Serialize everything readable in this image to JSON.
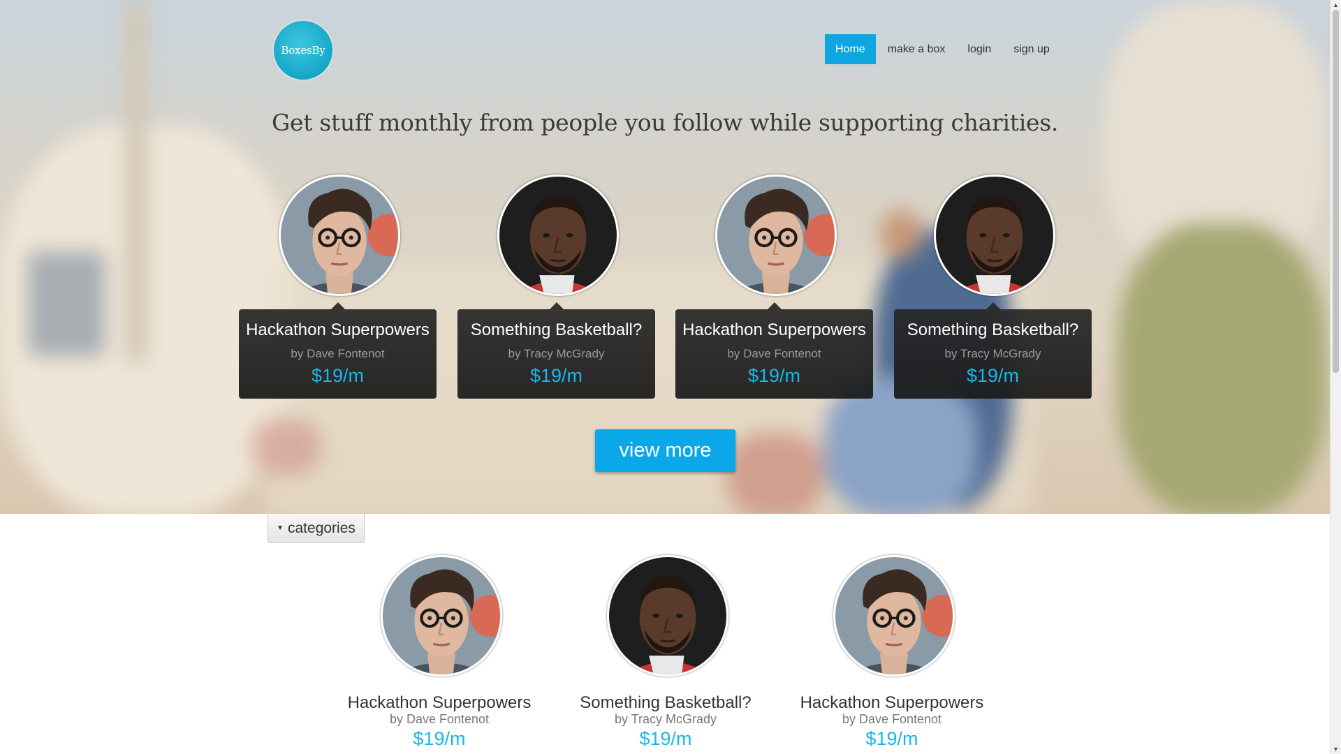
{
  "brand": {
    "logo_text": "BoxesBy"
  },
  "nav": [
    {
      "label": "Home",
      "active": true
    },
    {
      "label": "make a box",
      "active": false
    },
    {
      "label": "login",
      "active": false
    },
    {
      "label": "sign up",
      "active": false
    }
  ],
  "hero": {
    "tagline": "Get stuff monthly from people you follow while supporting charities.",
    "view_more_label": "view more",
    "cards": [
      {
        "title": "Hackathon Superpowers",
        "author": "by Dave Fontenot",
        "price": "$19/m",
        "person": "dave"
      },
      {
        "title": "Something Basketball?",
        "author": "by Tracy McGrady",
        "price": "$19/m",
        "person": "tracy"
      },
      {
        "title": "Hackathon Superpowers",
        "author": "by Dave Fontenot",
        "price": "$19/m",
        "person": "dave"
      },
      {
        "title": "Something Basketball?",
        "author": "by Tracy McGrady",
        "price": "$19/m",
        "person": "tracy"
      }
    ]
  },
  "categories": {
    "label": "categories"
  },
  "listing": [
    {
      "title": "Hackathon Superpowers",
      "author": "by Dave Fontenot",
      "price": "$19/m",
      "person": "dave"
    },
    {
      "title": "Something Basketball?",
      "author": "by Tracy McGrady",
      "price": "$19/m",
      "person": "tracy"
    },
    {
      "title": "Hackathon Superpowers",
      "author": "by Dave Fontenot",
      "price": "$19/m",
      "person": "dave"
    }
  ],
  "colors": {
    "accent": "#0ea5e0",
    "price": "#19b6ea",
    "logo": "#16a6c8",
    "card_bg": "#282828"
  }
}
